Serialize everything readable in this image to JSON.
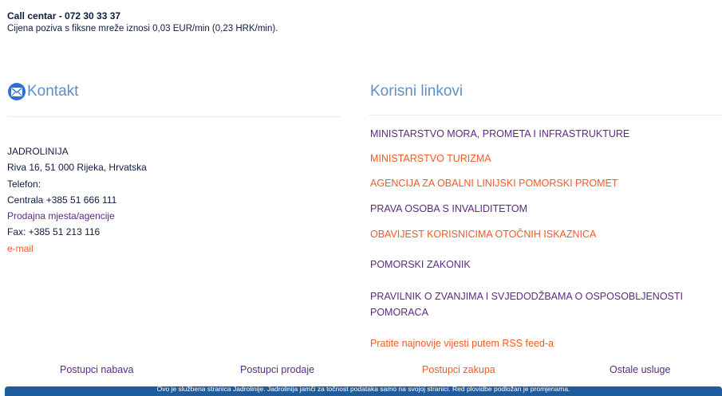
{
  "call_center": {
    "title": "Call centar - 072 30 33 37",
    "note": "Cijena poziva s fiksne mreže iznosi 0,03 EUR/min (0,23 HRK/min)."
  },
  "kontakt": {
    "title": "Kontakt",
    "icon": "envelope-icon",
    "company": "JADROLINIJA",
    "address": "Riva 16, 51 000 Rijeka, Hrvatska",
    "phone_label": "Telefon:",
    "switchboard": "Centrala +385 51 666 111",
    "sales_points": "Prodajna mjesta/agencije",
    "fax": "Fax: +385 51 213 116",
    "email": "e-mail"
  },
  "useful_links": {
    "title": "Korisni linkovi",
    "items": [
      {
        "label": "MINISTARSTVO MORA, PROMETA I INFRASTRUKTURE",
        "color": "#5b2a86"
      },
      {
        "label": "MINISTARSTVO TURIZMA",
        "color": "#f15a24"
      },
      {
        "label": "AGENCIJA ZA OBALNI LINIJSKI POMORSKI PROMET",
        "color": "#f15a24"
      },
      {
        "label": "PRAVA OSOBA S INVALIDITETOM",
        "color": "#5b2a86"
      },
      {
        "label": "OBAVIJEST KORISNICIMA OTOČNIH ISKAZNICA",
        "color": "#f15a24"
      },
      {
        "label": "POMORSKI ZAKONIK",
        "color": "#5b2a86"
      },
      {
        "label": "PRAVILNIK O ZVANJIMA I SVJEDODŽBAMA O OSPOSOBLJENOSTI POMORACA",
        "color": "#5b2a86"
      }
    ],
    "rss": "Pratite najnovije vijesti putem RSS feed-a"
  },
  "bottom_links": [
    {
      "label": "Postupci nabava",
      "color": "#5b2a86"
    },
    {
      "label": "Postupci prodaje",
      "color": "#5b2a86"
    },
    {
      "label": "Postupci zakupa",
      "color": "#f15a24"
    },
    {
      "label": "Ostale usluge",
      "color": "#5b2a86"
    }
  ],
  "footer": {
    "text": "Ovo je službena stranica Jadrolinije. Jadrolinija jamči za točnost podataka samo na svojoj stranici. Red plovidbe podložan je promjenama."
  }
}
